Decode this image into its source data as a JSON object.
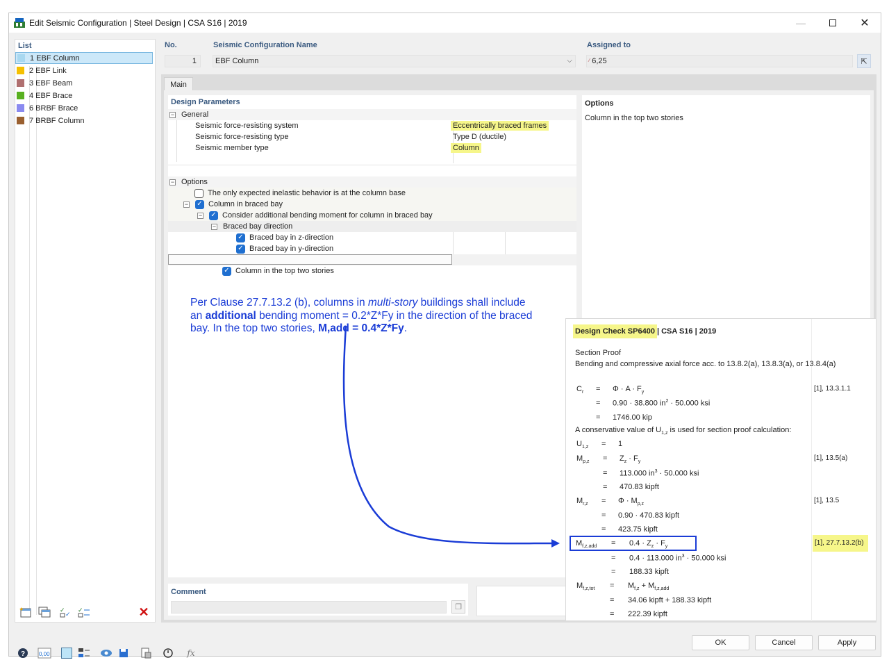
{
  "window": {
    "title": "Edit Seismic Configuration | Steel Design | CSA S16 | 2019",
    "minimize_icon": "minimize-icon",
    "maximize_icon": "maximize-icon",
    "close_icon": "close-icon"
  },
  "list": {
    "header": "List",
    "items": [
      {
        "label": "1 EBF Column",
        "color": "#a8d8f0"
      },
      {
        "label": "2 EBF Link",
        "color": "#f5c000"
      },
      {
        "label": "3 EBF Beam",
        "color": "#b07070"
      },
      {
        "label": "4 EBF Brace",
        "color": "#58b020"
      },
      {
        "label": "6 BRBF Brace",
        "color": "#8a8af0"
      },
      {
        "label": "7 BRBF Column",
        "color": "#9a6030"
      }
    ]
  },
  "config": {
    "no_label": "No.",
    "no_value": "1",
    "name_label": "Seismic Configuration Name",
    "name_value": "EBF Column",
    "assigned_label": "Assigned to",
    "assigned_value": "6,25"
  },
  "tabs": [
    "Main"
  ],
  "design_params": {
    "header": "Design Parameters",
    "general_label": "General",
    "rows": [
      {
        "label": "Seismic force-resisting system",
        "value": "Eccentrically braced frames"
      },
      {
        "label": "Seismic force-resisting type",
        "value": "Type D (ductile)"
      },
      {
        "label": "Seismic member type",
        "value": "Column"
      }
    ],
    "options_label": "Options",
    "options": [
      {
        "label": "The only expected inelastic behavior is at the column base",
        "checked": false
      },
      {
        "label": "Column in braced bay",
        "checked": true
      },
      {
        "label": "Consider additional bending moment for column in braced bay",
        "checked": true
      },
      {
        "label": "Braced bay direction"
      },
      {
        "label": "Braced bay in z-direction",
        "checked": true
      },
      {
        "label": "Braced bay in y-direction",
        "checked": true
      },
      {
        "label": "Column in the top two stories",
        "checked": true
      }
    ]
  },
  "options_panel": {
    "header": "Options",
    "text": "Column in the top two stories"
  },
  "annotation": {
    "line1_a": "Per Clause 27.7.13.2 (b), columns in ",
    "line1_b": "multi-story",
    "line1_c": " buildings shall include",
    "line2_a": "an ",
    "line2_b": "additional",
    "line2_c": " bending moment = 0.2*Z*Fy in the direction of the braced",
    "line3_a": "bay. In the top two stories, ",
    "line3_b": "M,add = 0.4*Z*Fy",
    "line3_c": ".",
    "color": "#1a3cd6"
  },
  "design_check": {
    "title_highlight": "Design Check SP6400",
    "title_rest": " | CSA S16 | 2019",
    "section": "Section Proof",
    "desc": "Bending and compressive axial force acc. to 13.8.2(a), 13.8.3(a), or 13.8.4(a)",
    "cr_sym": "C",
    "cr_sub": "r",
    "cr_eq1": "Φ · A · F",
    "cr_eq1_sub": "y",
    "cr_ref": "[1], 13.3.1.1",
    "cr_eq2a": "0.90 · 38.800 in",
    "cr_eq2_sup": "2",
    "cr_eq2b": " · 50.000 ksi",
    "cr_eq3": "1746.00 kip",
    "note_a": "A conservative value of U",
    "note_sub": "1,z",
    "note_b": " is used for section proof calculation:",
    "u_sym": "U",
    "u_sub": "1,z",
    "u_val": "1",
    "mp_sym": "M",
    "mp_sub": "p,z",
    "mp_eq1a": "Z",
    "mp_eq1_sub1": "z",
    "mp_eq1b": " · F",
    "mp_eq1_sub2": "y",
    "mp_ref": "[1], 13.5(a)",
    "mp_eq2a": "113.000 in",
    "mp_eq2_sup": "3",
    "mp_eq2b": " · 50.000 ksi",
    "mp_eq3": "470.83 kipft",
    "mr_sym": "M",
    "mr_sub": "r,z",
    "mr_eq1a": "Φ · M",
    "mr_eq1_sub": "p,z",
    "mr_ref": "[1], 13.5",
    "mr_eq2": "0.90 · 470.83 kipft",
    "mr_eq3": "423.75 kipft",
    "mf_sym": "M",
    "mf_sub": "f,z,add",
    "mf_eq1a": "0.4 · Z",
    "mf_eq1_sub1": "z",
    "mf_eq1b": " · F",
    "mf_eq1_sub2": "y",
    "mf_ref": "[1], 27.7.13.2(b)",
    "mf_eq2a": "0.4 · 113.000 in",
    "mf_eq2_sup": "3",
    "mf_eq2b": " · 50.000 ksi",
    "mf_eq3": "188.33 kipft",
    "mt_sym": "M",
    "mt_sub": "f,z,tot",
    "mt_eq1a": "M",
    "mt_eq1_sub1": "f,z",
    "mt_eq1b": " + M",
    "mt_eq1_sub2": "f,z,add",
    "mt_eq2": "34.06 kipft + 188.33 kipft",
    "mt_eq3": "222.39 kipft",
    "eq": "="
  },
  "comment": {
    "label": "Comment",
    "value": ""
  },
  "buttons": {
    "ok": "OK",
    "cancel": "Cancel",
    "apply": "Apply"
  }
}
